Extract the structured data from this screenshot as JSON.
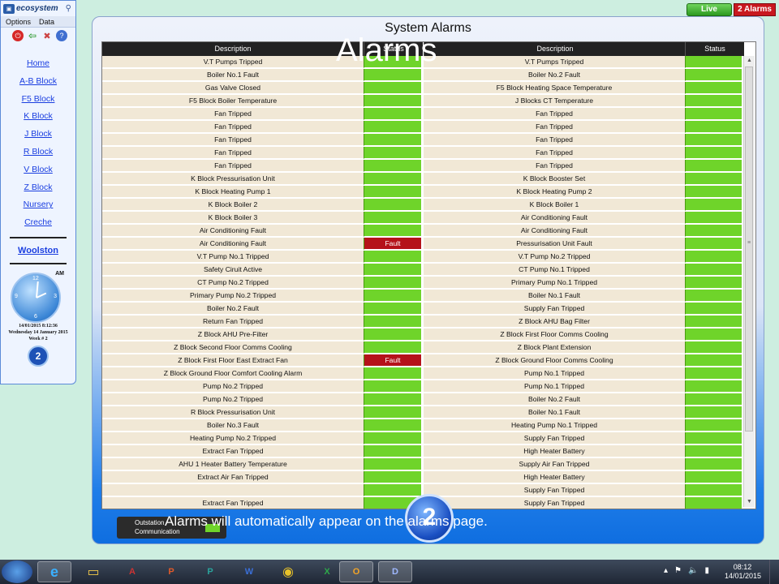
{
  "sidebar": {
    "logo_text": "ecosystem",
    "menu": [
      "Options",
      "Data"
    ],
    "nav": [
      "Home",
      "A-B Block",
      "F5 Block",
      "K Block",
      "J Block",
      "R Block",
      "V Block",
      "Z Block",
      "Nursery",
      "Creche"
    ],
    "site": "Woolston",
    "clock": {
      "ampm": "AM",
      "numbers": [
        "12",
        "3",
        "6",
        "9"
      ],
      "date_short": "14/01/2015 8:12:36",
      "date_long": "Wednesday 14 January 2015",
      "week": "Week # 2"
    }
  },
  "top_buttons": {
    "live": "Live",
    "alarms": "2 Alarms"
  },
  "panel": {
    "title": "System Alarms",
    "overlay_title": "Alarms"
  },
  "table": {
    "headers": {
      "description": "Description",
      "status": "Status"
    },
    "fault_label": "Fault",
    "left": [
      {
        "d": "V.T Pumps Tripped",
        "f": false
      },
      {
        "d": "Boiler No.1 Fault",
        "f": false
      },
      {
        "d": "Gas Valve Closed",
        "f": false
      },
      {
        "d": "F5 Block Boiler Temperature",
        "f": false
      },
      {
        "d": "Fan Tripped",
        "f": false
      },
      {
        "d": "Fan Tripped",
        "f": false
      },
      {
        "d": "Fan Tripped",
        "f": false
      },
      {
        "d": "Fan Tripped",
        "f": false
      },
      {
        "d": "Fan Tripped",
        "f": false
      },
      {
        "d": "K Block Pressurisation Unit",
        "f": false
      },
      {
        "d": "K Block Heating Pump 1",
        "f": false
      },
      {
        "d": "K Block Boiler 2",
        "f": false
      },
      {
        "d": "K Block Boiler 3",
        "f": false
      },
      {
        "d": "Air Conditioning Fault",
        "f": false
      },
      {
        "d": "Air Conditioning Fault",
        "f": true
      },
      {
        "d": "V.T Pump No.1 Tripped",
        "f": false
      },
      {
        "d": "Safety Ciruit Active",
        "f": false
      },
      {
        "d": "CT Pump No.2 Tripped",
        "f": false
      },
      {
        "d": "Primary Pump No.2 Tripped",
        "f": false
      },
      {
        "d": "Boiler No.2 Fault",
        "f": false
      },
      {
        "d": "Return Fan Tripped",
        "f": false
      },
      {
        "d": "Z Block AHU Pre-Filter",
        "f": false
      },
      {
        "d": "Z Block Second Floor Comms Cooling",
        "f": false
      },
      {
        "d": "Z Block First Floor East Extract Fan",
        "f": true
      },
      {
        "d": "Z Block Ground Floor Comfort Cooling Alarm",
        "f": false
      },
      {
        "d": "Pump No.2 Tripped",
        "f": false
      },
      {
        "d": "Pump No.2 Tripped",
        "f": false
      },
      {
        "d": "R Block Pressurisation Unit",
        "f": false
      },
      {
        "d": "Boiler No.3 Fault",
        "f": false
      },
      {
        "d": "Heating Pump No.2 Tripped",
        "f": false
      },
      {
        "d": "Extract Fan Tripped",
        "f": false
      },
      {
        "d": "AHU 1 Heater Battery Temperature",
        "f": false
      },
      {
        "d": "Extract Air Fan Tripped",
        "f": false
      },
      {
        "d": "",
        "f": false
      },
      {
        "d": "Extract Fan Tripped",
        "f": false
      }
    ],
    "right": [
      {
        "d": "V.T Pumps Tripped",
        "f": false
      },
      {
        "d": "Boiler No.2 Fault",
        "f": false
      },
      {
        "d": "F5 Block Heating Space Temperature",
        "f": false
      },
      {
        "d": "J Blocks CT Temperature",
        "f": false
      },
      {
        "d": "Fan Tripped",
        "f": false
      },
      {
        "d": "Fan Tripped",
        "f": false
      },
      {
        "d": "Fan Tripped",
        "f": false
      },
      {
        "d": "Fan Tripped",
        "f": false
      },
      {
        "d": "Fan Tripped",
        "f": false
      },
      {
        "d": "K Block Booster Set",
        "f": false
      },
      {
        "d": "K Block Heating Pump 2",
        "f": false
      },
      {
        "d": "K Block Boiler 1",
        "f": false
      },
      {
        "d": "Air Conditioning Fault",
        "f": false
      },
      {
        "d": "Air Conditioning Fault",
        "f": false
      },
      {
        "d": "Pressurisation Unit Fault",
        "f": false
      },
      {
        "d": "V.T Pump No.2 Tripped",
        "f": false
      },
      {
        "d": "CT Pump No.1 Tripped",
        "f": false
      },
      {
        "d": "Primary Pump No.1 Tripped",
        "f": false
      },
      {
        "d": "Boiler No.1 Fault",
        "f": false
      },
      {
        "d": "Supply Fan Tripped",
        "f": false
      },
      {
        "d": "Z Block AHU Bag Filter",
        "f": false
      },
      {
        "d": "Z Block First Floor Comms Cooling",
        "f": false
      },
      {
        "d": "Z Block Plant Extension",
        "f": false
      },
      {
        "d": "Z Block Ground Floor Comms Cooling",
        "f": false
      },
      {
        "d": "Pump No.1 Tripped",
        "f": false
      },
      {
        "d": "Pump No.1 Tripped",
        "f": false
      },
      {
        "d": "Boiler No.2 Fault",
        "f": false
      },
      {
        "d": "Boiler No.1 Fault",
        "f": false
      },
      {
        "d": "Heating Pump No.1 Tripped",
        "f": false
      },
      {
        "d": "Supply Fan Tripped",
        "f": false
      },
      {
        "d": "High Heater Battery",
        "f": false
      },
      {
        "d": "Supply Air Fan Tripped",
        "f": false
      },
      {
        "d": "High Heater Battery",
        "f": false
      },
      {
        "d": "Supply Fan Tripped",
        "f": false
      },
      {
        "d": "Supply Fan Tripped",
        "f": false
      }
    ]
  },
  "outstation": {
    "line1": "Outstation",
    "line2": "Communication"
  },
  "caption": "Alarms will automatically appear on the alarms page.",
  "taskbar": {
    "apps": [
      "internet-explorer",
      "file-explorer",
      "access",
      "powerpoint",
      "publisher",
      "word",
      "chrome",
      "excel",
      "outlook",
      "remote-app"
    ],
    "time": "08:12",
    "date": "14/01/2015"
  },
  "colors": {
    "status_ok": "#6fd42a",
    "status_fault": "#b5121a",
    "row_bg": "#f1e8d6",
    "header_bg": "#222222"
  }
}
